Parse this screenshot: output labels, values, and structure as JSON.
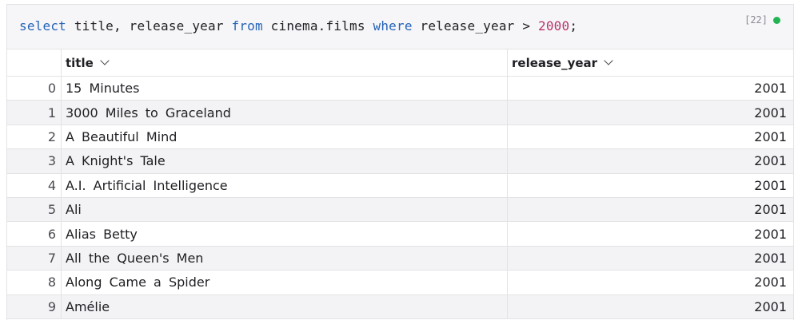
{
  "cell": {
    "execution_count": "[22]",
    "status_color": "#22b454",
    "query": {
      "kw_select": "select",
      "columns": " title, release_year ",
      "kw_from": "from",
      "table": " cinema.films ",
      "kw_where": "where",
      "condition": " release_year > ",
      "value": "2000",
      "terminator": ";"
    }
  },
  "table": {
    "columns": [
      "title",
      "release_year"
    ],
    "rows": [
      {
        "idx": "0",
        "title": "15 Minutes",
        "year": "2001"
      },
      {
        "idx": "1",
        "title": "3000 Miles to Graceland",
        "year": "2001"
      },
      {
        "idx": "2",
        "title": "A Beautiful Mind",
        "year": "2001"
      },
      {
        "idx": "3",
        "title": "A Knight's Tale",
        "year": "2001"
      },
      {
        "idx": "4",
        "title": "A.I. Artificial Intelligence",
        "year": "2001"
      },
      {
        "idx": "5",
        "title": "Ali",
        "year": "2001"
      },
      {
        "idx": "6",
        "title": "Alias Betty",
        "year": "2001"
      },
      {
        "idx": "7",
        "title": "All the Queen's Men",
        "year": "2001"
      },
      {
        "idx": "8",
        "title": "Along Came a Spider",
        "year": "2001"
      },
      {
        "idx": "9",
        "title": "Amélie",
        "year": "2001"
      }
    ]
  }
}
